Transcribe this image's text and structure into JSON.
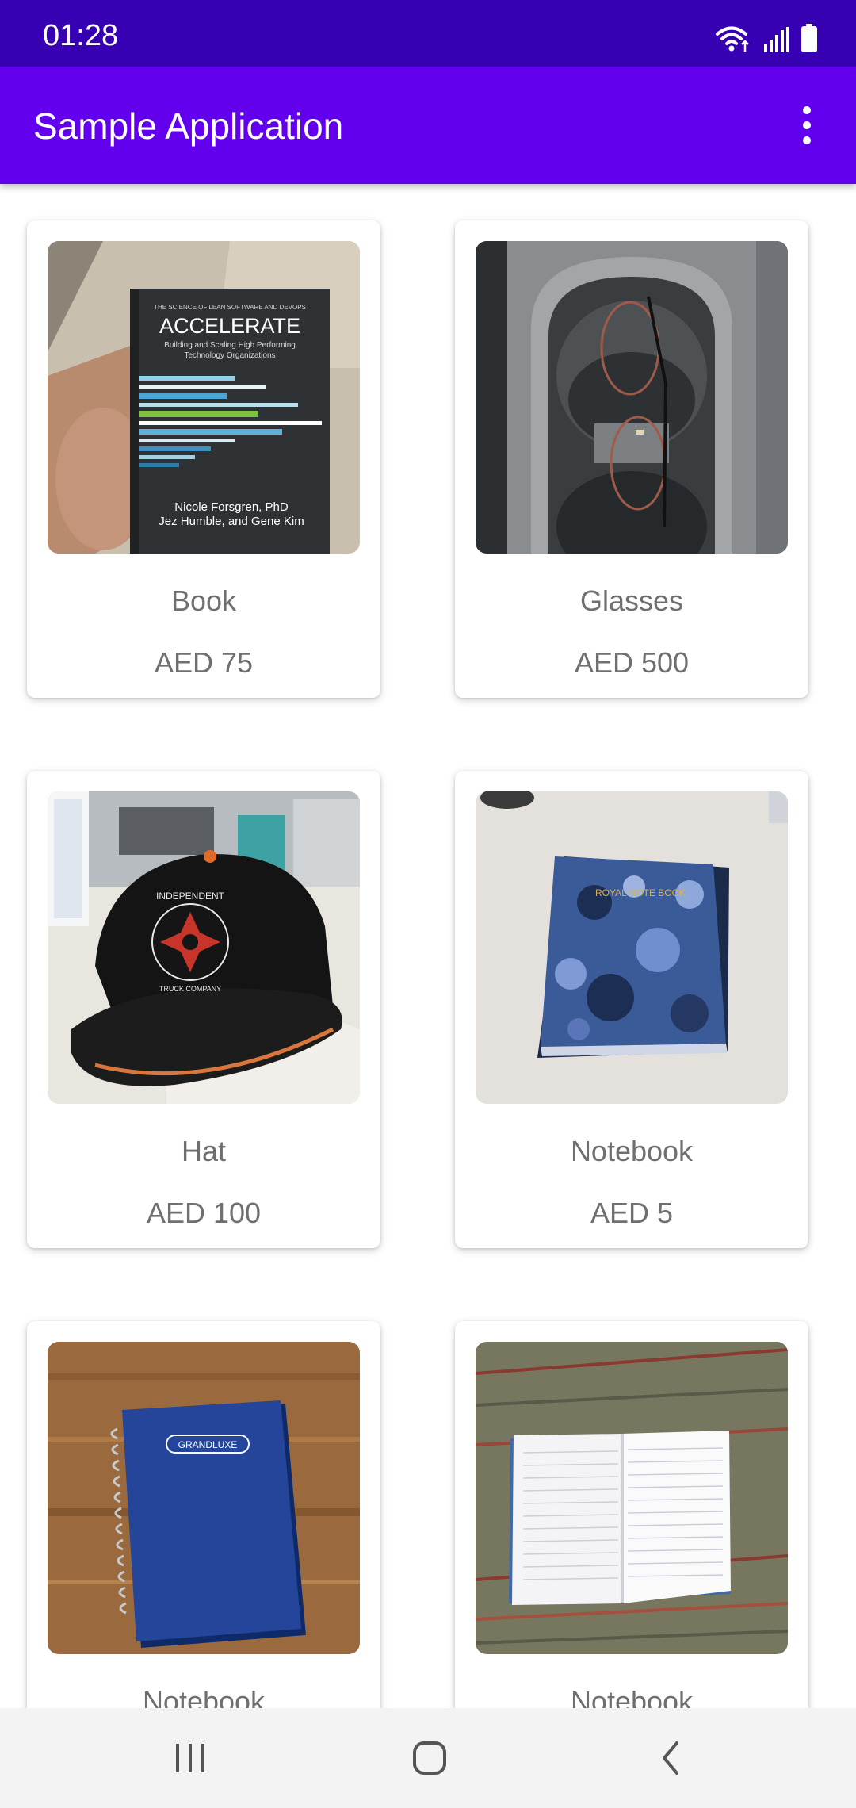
{
  "status_bar": {
    "time": "01:28",
    "icons": [
      "wifi-icon",
      "signal-icon",
      "battery-icon"
    ]
  },
  "app_bar": {
    "title": "Sample Application",
    "menu_icon": "more-vert-icon"
  },
  "colors": {
    "status_bar": "#3700b3",
    "app_bar": "#6200ee",
    "card_text": "#6f6f6f"
  },
  "products": [
    {
      "name": "Book",
      "price": "AED 75",
      "image": "accelerate-book-photo"
    },
    {
      "name": "Glasses",
      "price": "AED 500",
      "image": "glasses-cupholder-photo"
    },
    {
      "name": "Hat",
      "price": "AED 100",
      "image": "black-cap-photo"
    },
    {
      "name": "Notebook",
      "price": "AED 5",
      "image": "royal-notebook-photo"
    },
    {
      "name": "Notebook",
      "price": "",
      "image": "grandluxe-notebook-photo"
    },
    {
      "name": "Notebook",
      "price": "",
      "image": "open-notebook-photo"
    }
  ],
  "image_text": {
    "book_series": "THE SCIENCE OF LEAN SOFTWARE AND DEVOPS",
    "book_title": "ACCELERATE",
    "book_subtitle_1": "Building and Scaling High Performing",
    "book_subtitle_2": "Technology Organizations",
    "book_authors_1": "Nicole Forsgren, PhD",
    "book_authors_2": "Jez Humble, and Gene Kim",
    "hat_logo": "INDEPENDENT",
    "hat_logo_sub": "TRUCK COMPANY",
    "royal_label": "ROYAL NOTE BOOK",
    "grandluxe_label": "GRANDLUXE"
  },
  "nav_bar": {
    "buttons": [
      "recents-icon",
      "home-icon",
      "back-icon"
    ]
  }
}
